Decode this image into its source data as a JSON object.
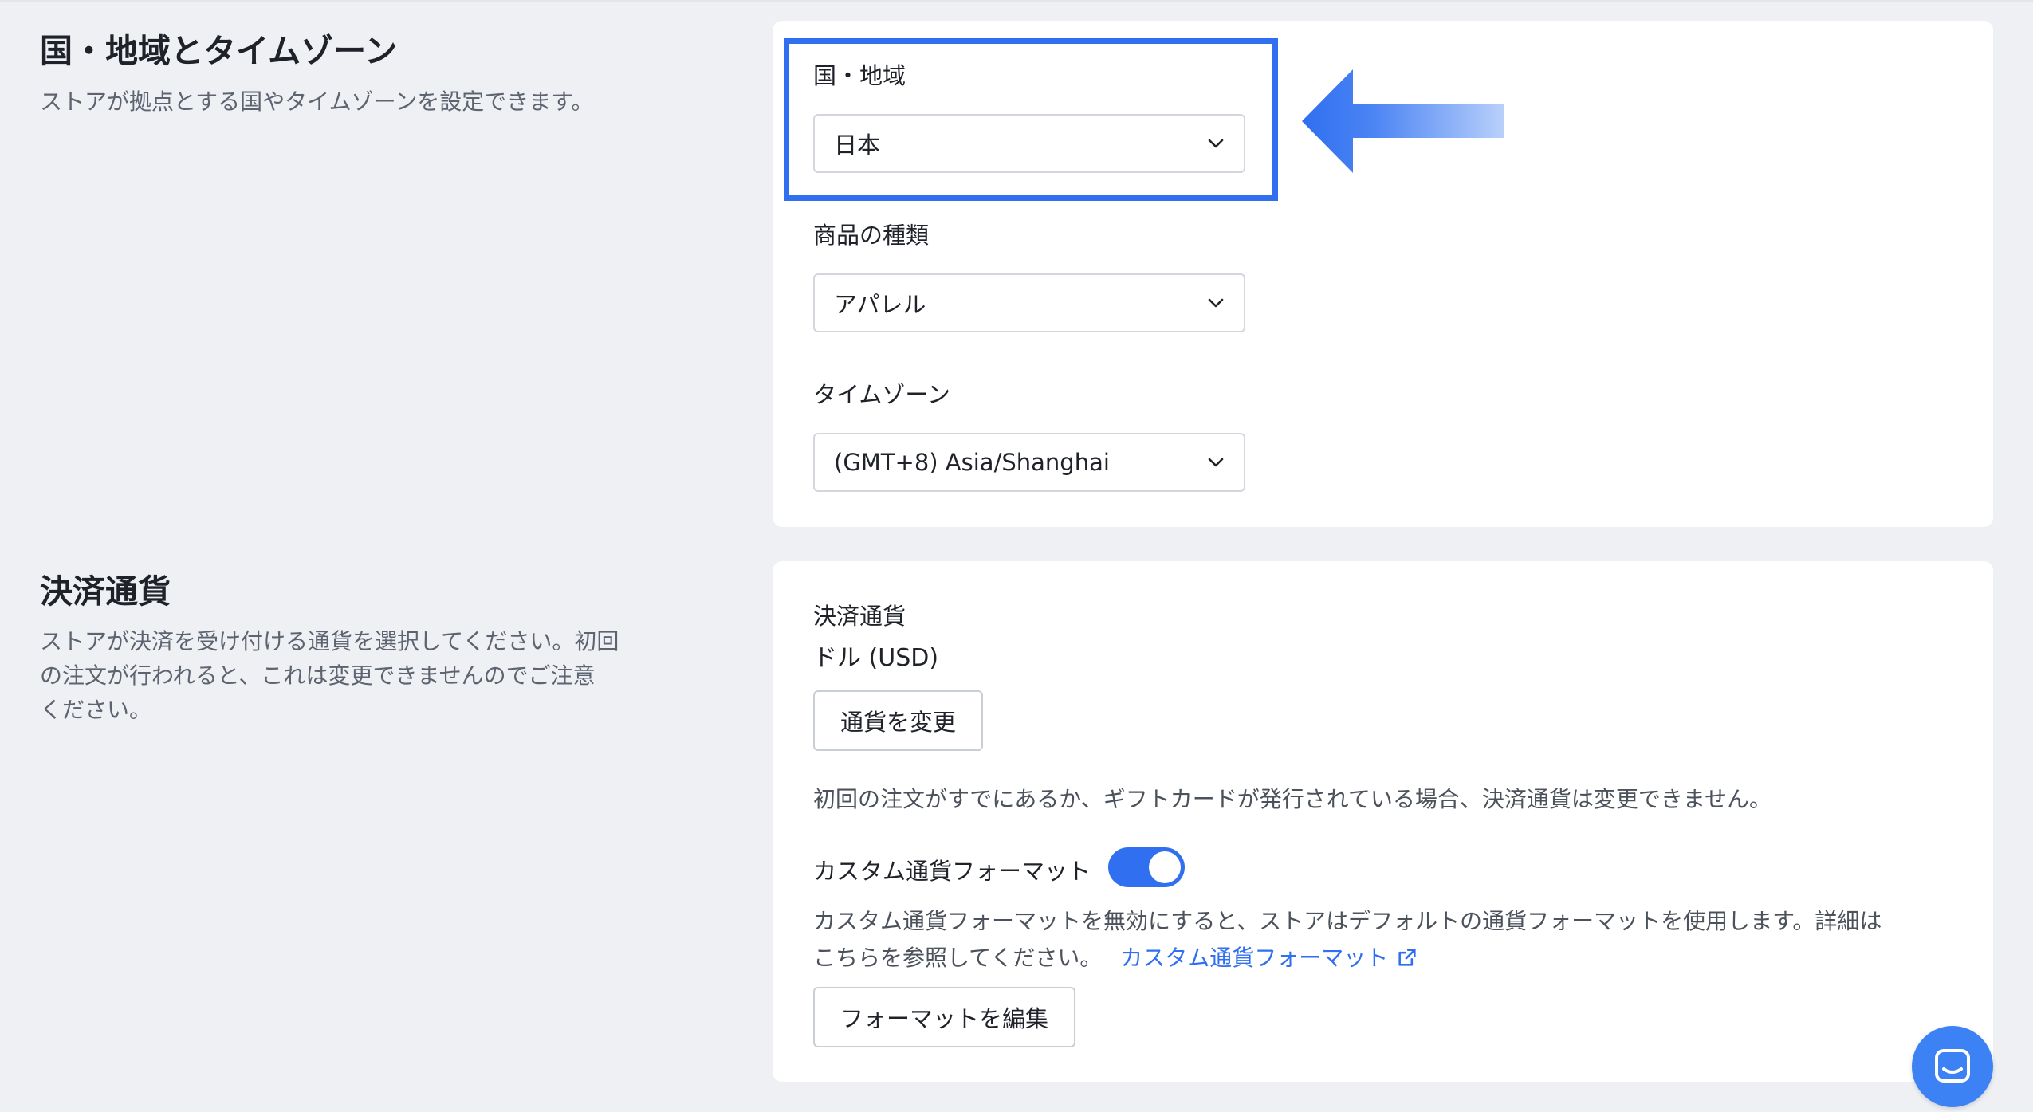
{
  "region_section": {
    "title": "国・地域とタイムゾーン",
    "description": "ストアが拠点とする国やタイムゾーンを設定できます。",
    "country": {
      "label": "国・地域",
      "value": "日本"
    },
    "product_type": {
      "label": "商品の種類",
      "value": "アパレル"
    },
    "timezone": {
      "label": "タイムゾーン",
      "value": "(GMT+8) Asia/Shanghai"
    }
  },
  "currency_section": {
    "title": "決済通貨",
    "description_lines": [
      "ストアが決済を受け付ける通貨を選択してください。初回",
      "の注文が行われると、これは変更できませんのでご注意",
      "ください。"
    ],
    "currency_label": "決済通貨",
    "currency_value": "ドル (USD)",
    "change_button": "通貨を変更",
    "note": "初回の注文がすでにあるか、ギフトカードが発行されている場合、決済通貨は変更できません。",
    "custom_format": {
      "label": "カスタム通貨フォーマット",
      "enabled": true,
      "desc_line1": "カスタム通貨フォーマットを無効にすると、ストアはデフォルトの通貨フォーマットを使用します。詳細は",
      "desc_line2": "こちらを参照してください。",
      "link_text": "カスタム通貨フォーマット",
      "edit_button": "フォーマットを編集"
    }
  },
  "colors": {
    "accent": "#2f6ff0",
    "background": "#eef0f4",
    "card": "#ffffff"
  },
  "icons": {
    "arrow": "left-arrow-icon",
    "chat": "chat-icon",
    "external_link": "external-link-icon"
  }
}
